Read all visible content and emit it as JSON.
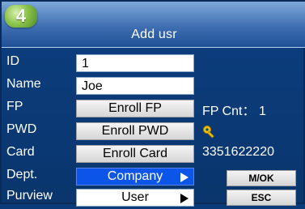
{
  "header": {
    "step_number": "4",
    "title": "Add usr"
  },
  "form": {
    "id": {
      "label": "ID",
      "value": "1"
    },
    "name": {
      "label": "Name",
      "value": "Joe"
    },
    "fp": {
      "label": "FP",
      "button_label": "Enroll FP",
      "info": "FP Cnt： 1"
    },
    "pwd": {
      "label": "PWD",
      "button_label": "Enroll PWD",
      "icon": "key-icon"
    },
    "card": {
      "label": "Card",
      "button_label": "Enroll Card",
      "info": "3351622220"
    },
    "dept": {
      "label": "Dept.",
      "selected": "Company"
    },
    "purview": {
      "label": "Purview",
      "selected": "User"
    }
  },
  "actions": {
    "mok_label": "M/OK",
    "esc_label": "ESC"
  },
  "colors": {
    "background": "#0c3f80",
    "selected_field": "#0b55e8",
    "button": "#d6d6d6",
    "badge": "#8bc34a",
    "key_icon": "#f2c200"
  }
}
